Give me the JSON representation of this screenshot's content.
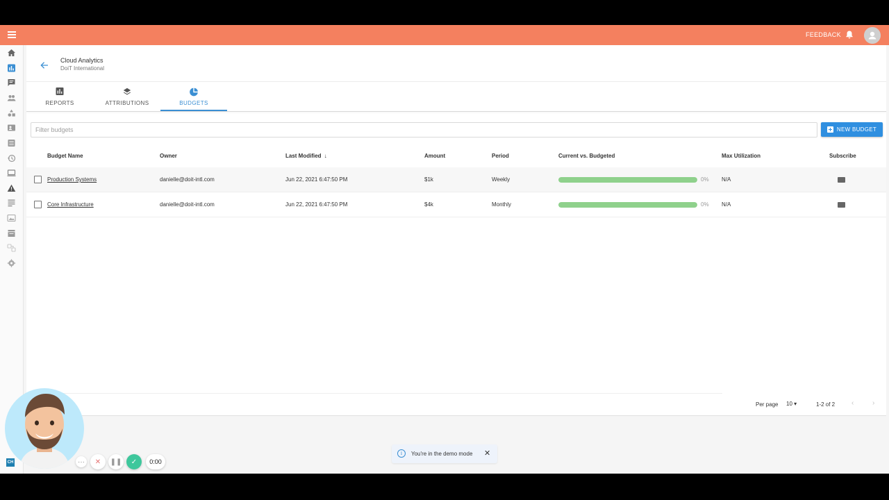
{
  "header": {
    "feedback_label": "FEEDBACK"
  },
  "breadcrumb": {
    "title": "Cloud Analytics",
    "subtitle": "DoiT International"
  },
  "tabs": [
    {
      "label": "REPORTS",
      "icon": "bar-chart-icon",
      "active": false
    },
    {
      "label": "ATTRIBUTIONS",
      "icon": "layers-icon",
      "active": false
    },
    {
      "label": "BUDGETS",
      "icon": "pie-chart-icon",
      "active": true
    }
  ],
  "filter": {
    "placeholder": "Filter budgets",
    "value": ""
  },
  "toolbar": {
    "new_budget_label": "NEW BUDGET"
  },
  "table": {
    "columns": [
      "Budget Name",
      "Owner",
      "Last Modified",
      "Amount",
      "Period",
      "Current vs. Budgeted",
      "Max Utilization",
      "Subscribe"
    ],
    "rows": [
      {
        "name": "Production Systems",
        "owner": "danielle@doit-intl.com",
        "modified": "Jun 22, 2021 6:47:50 PM",
        "amount": "$1k",
        "period": "Weekly",
        "utilization_fraction": 1.0,
        "pct": "0%",
        "max": "N/A"
      },
      {
        "name": "Core Infrastructure",
        "owner": "danielle@doit-intl.com",
        "modified": "Jun 22, 2021 6:47:50 PM",
        "amount": "$4k",
        "period": "Monthly",
        "utilization_fraction": 1.0,
        "pct": "0%",
        "max": "N/A"
      }
    ]
  },
  "pagination": {
    "per_page_label": "Per page",
    "per_page_value": "10",
    "range": "1-2 of 2"
  },
  "toast": {
    "text": "You're in the demo mode"
  },
  "recorder": {
    "timer": "0:00",
    "badge": "CH"
  },
  "colors": {
    "topbar": "#f4805f",
    "accent": "#3b8fd3",
    "progress": "#8fd18c"
  }
}
